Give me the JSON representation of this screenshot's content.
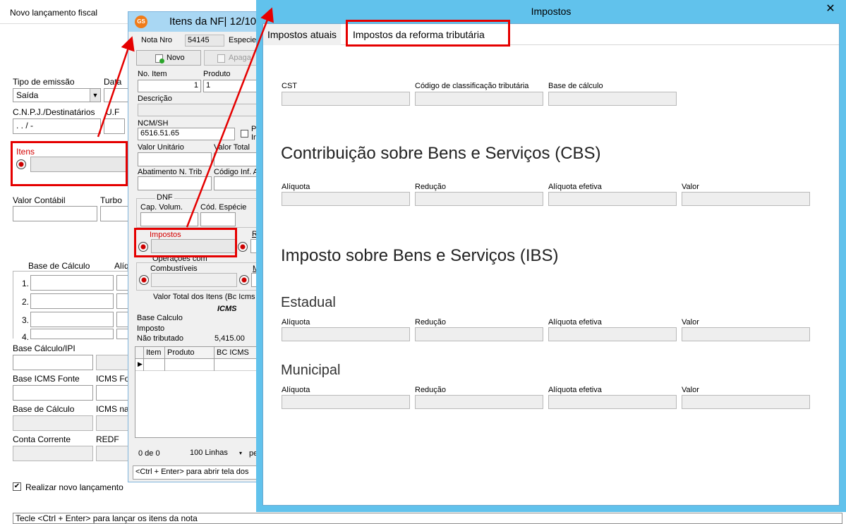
{
  "main": {
    "title": "Novo lançamento fiscal",
    "tipo_emissao_label": "Tipo de emissão",
    "tipo_emissao_value": "Saída",
    "data_label": "Data",
    "cnpj_label": "C.N.P.J./Destinatários",
    "cnpj_mask": " .  .  /   -",
    "uf_label": "U.F",
    "itens_label": "Itens",
    "valor_contabil_label": "Valor Contábil",
    "turbo_label": "Turbo",
    "base_calculo_label": "Base de Cálculo",
    "aliquota_label": "Alíq",
    "rows": [
      "1.",
      "2.",
      "3.",
      "4."
    ],
    "base_calculo_ipi_label": "Base Cálculo/IPI",
    "base_icms_fonte_label": "Base ICMS Fonte",
    "icms_fonte_label": "ICMS Fo",
    "base_calculo2_label": "Base de Cálculo",
    "icms_na_label": "ICMS na",
    "conta_corrente_label": "Conta Corrente",
    "redf_label": "REDF",
    "realizar_label": "Realizar novo lançamento",
    "status_bar": "Tecle <Ctrl + Enter> para lançar os itens da nota"
  },
  "itens": {
    "title": "Itens da NF|  12/10",
    "logo": "GS",
    "nota_nro_label": "Nota Nro",
    "nota_nro_value": "54145",
    "especie_label": "Especie",
    "novo_button": "Novo",
    "apagar_button": "Apaga",
    "no_item_label": "No. Item",
    "no_item_value": "1",
    "produto_label": "Produto",
    "produto_value": "1",
    "descricao_label": "Descrição",
    "ncm_label": "NCM/SH",
    "ncm_value": "6516.51.65",
    "p_label": "P",
    "i_label": "Ir",
    "valor_unitario_label": "Valor Unitário",
    "valor_total_label": "Valor Total",
    "abatimento_label": "Abatimento N. Trib",
    "codigo_inf_label": "Código Inf. A",
    "dnf_label": "DNF",
    "cap_volum_label": "Cap. Volum.",
    "cod_especie_label": "Cód. Espécie",
    "impostos_label": "Impostos",
    "r_label": "R",
    "operacoes_label": "Operações com",
    "combustiveis_label": "Combustíveis",
    "m_label": "M",
    "valor_total_itens_label": "Valor Total dos Itens  (Bc Icms",
    "icms_label": "ICMS",
    "base_calculo_label": "Base Calculo",
    "imposto_label": "Imposto",
    "nao_tributado_label": "Não tributado",
    "nao_tributado_value": "5,415.00",
    "grid_headers": [
      "Item",
      "Produto",
      "BC ICMS"
    ],
    "pager_count": "0  de  0",
    "pager_lines": "100 Linhas",
    "pager_suffix": "pe",
    "status_bar": "<Ctrl + Enter> para abrir tela dos"
  },
  "impostos": {
    "title": "Impostos",
    "close": "✕",
    "tabs": [
      "Impostos atuais",
      "Impostos da reforma tributária"
    ],
    "cst_label": "CST",
    "cod_class_label": "Código de classificação tributária",
    "base_calc_label": "Base de cálculo",
    "cbs_title": "Contribuição sobre Bens e Serviços (CBS)",
    "ibs_title": "Imposto sobre Bens e Serviços (IBS)",
    "estadual_title": "Estadual",
    "municipal_title": "Municipal",
    "aliquota_label": "Alíquota",
    "reducao_label": "Redução",
    "aliquota_efetiva_label": "Alíquota efetiva",
    "valor_label": "Valor"
  },
  "colors": {
    "accent_frame": "#5bc0eb",
    "highlight": "#e50000",
    "label_red": "#d40000"
  }
}
